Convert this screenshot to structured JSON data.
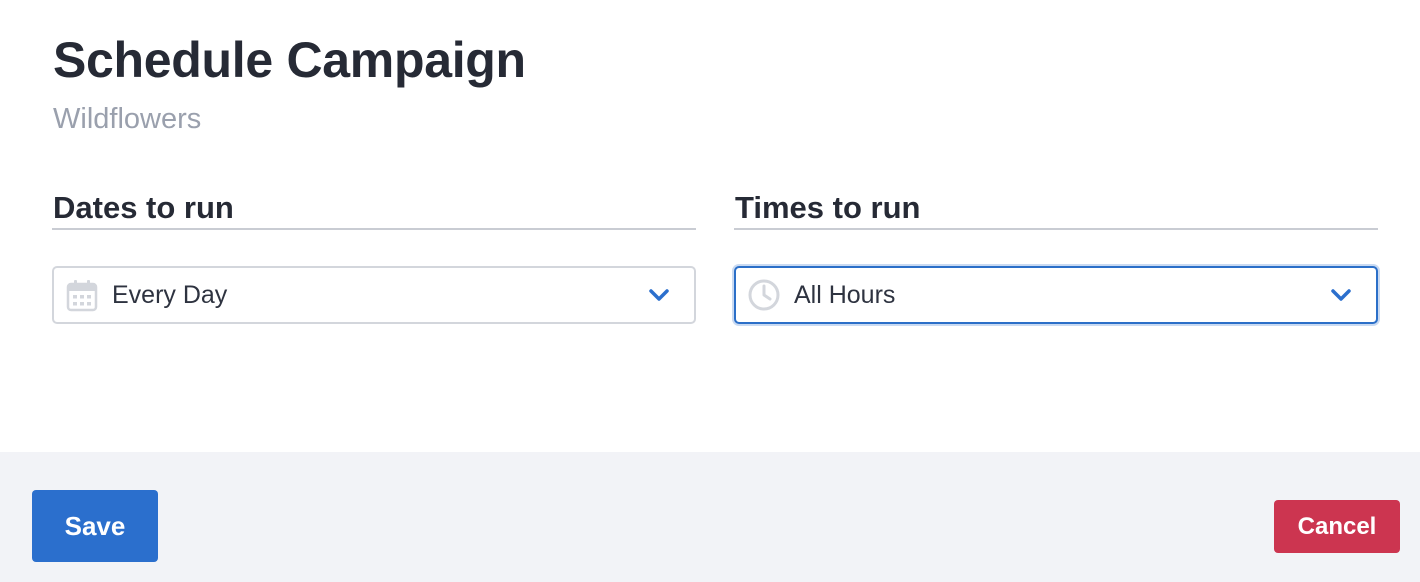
{
  "header": {
    "title": "Schedule Campaign",
    "subtitle": "Wildflowers"
  },
  "dates": {
    "label": "Dates to run",
    "selected_value": "Every Day",
    "icon": "calendar-icon"
  },
  "times": {
    "label": "Times to run",
    "selected_value": "All Hours",
    "icon": "clock-icon",
    "focused": true
  },
  "footer": {
    "save_label": "Save",
    "cancel_label": "Cancel"
  },
  "colors": {
    "primary": "#2b6fcd",
    "danger": "#cc3550",
    "focus_border": "#2b6fc8",
    "footer_bg": "#f2f3f7",
    "subtitle": "#9aa0ad"
  }
}
